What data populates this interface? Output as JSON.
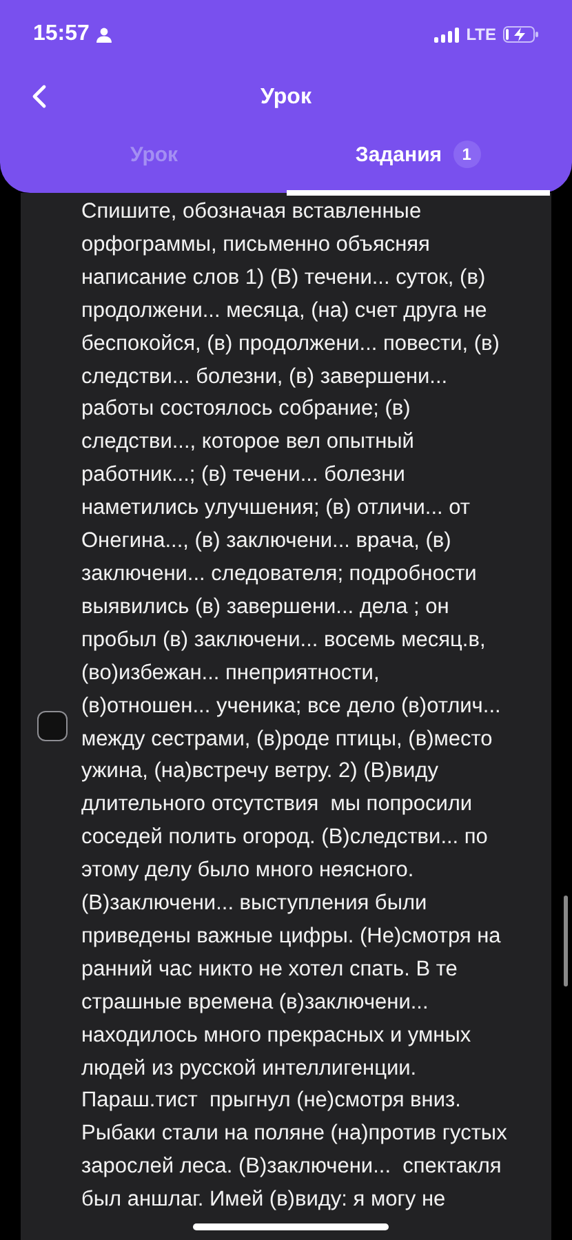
{
  "status_bar": {
    "time": "15:57",
    "network": "LTE"
  },
  "header": {
    "title": "Урок"
  },
  "tabs": [
    {
      "label": "Урок",
      "selected": false
    },
    {
      "label": "Задания",
      "badge": "1",
      "selected": true
    }
  ],
  "task": {
    "checked": false,
    "lines": [
      "Спишите, обозначая вставленные",
      "орфограммы, письменно объясняя",
      "написание слов 1) (В) течени... суток, (в)",
      "продолжени... месяца, (на) счет друга не",
      "беспокойся, (в) продолжени... повести, (в)",
      "следстви... болезни, (в) завершени...",
      "работы состоялось собрание; (в)",
      "следстви..., которое вел опытный",
      "работник...; (в) течени... болезни",
      "наметились улучшения; (в) отличи... от",
      "Онегина..., (в) заключени... врача, (в)",
      "заключени... следователя; подробности",
      "выявились (в) завершени... дела ; он",
      "пробыл (в) заключени... восемь месяц.в,",
      "(во)избежан... пнеприятности,",
      "(в)отношен... ученика; все дело (в)отлич...",
      "между сестрами, (в)роде птицы, (в)место",
      "ужина, (на)встречу ветру. 2) (В)виду",
      "длительного отсутствия  мы попросили",
      "соседей полить огород. (В)следстви... по",
      "этому делу было много неясного.",
      "(В)заключени... выступления были",
      "приведены важные цифры. (Не)смотря на",
      "ранний час никто не хотел спать. В те",
      "страшные времена (в)заключени...",
      "находилось много прекрасных и умных",
      "людей из русской интеллигенции.",
      "Параш.тист  прыгнул (не)смотря вниз.",
      "Рыбаки стали на поляне (на)против густых",
      "зарослей леса. (В)заключени...  спектакля",
      "был аншлаг. Имей (в)виду: я могу не"
    ]
  }
}
